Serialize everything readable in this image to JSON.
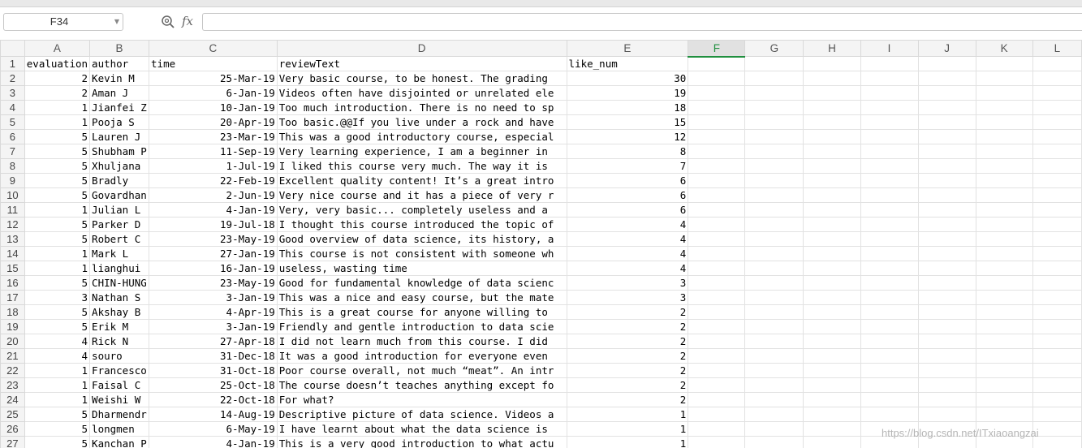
{
  "formula_bar": {
    "name_box": "F34",
    "formula_value": "",
    "zoom_icon": "zoom-magnifier-icon",
    "fx_label": "fx"
  },
  "columns": [
    "A",
    "B",
    "C",
    "D",
    "E",
    "F",
    "G",
    "H",
    "I",
    "J",
    "K",
    "L"
  ],
  "active_column": "F",
  "headers": {
    "row_number": "1",
    "evaluation": "evaluation",
    "author": "author",
    "time": "time",
    "reviewText": "reviewText",
    "like_num": "like_num"
  },
  "rows": [
    {
      "n": "2",
      "evaluation": "2",
      "author": "Kevin M",
      "time": "25-Mar-19",
      "reviewText": "Very basic course, to be honest. The grading",
      "like_num": "30"
    },
    {
      "n": "3",
      "evaluation": "2",
      "author": "Aman J",
      "time": "6-Jan-19",
      "reviewText": "Videos often have disjointed or unrelated ele",
      "like_num": "19"
    },
    {
      "n": "4",
      "evaluation": "1",
      "author": "Jianfei Z",
      "time": "10-Jan-19",
      "reviewText": "Too much introduction. There is no need to sp",
      "like_num": "18"
    },
    {
      "n": "5",
      "evaluation": "1",
      "author": "Pooja S",
      "time": "20-Apr-19",
      "reviewText": "Too basic.@@If you live under a rock and have",
      "like_num": "15"
    },
    {
      "n": "6",
      "evaluation": "5",
      "author": "Lauren J",
      "time": "23-Mar-19",
      "reviewText": "This was a good introductory course, especial",
      "like_num": "12"
    },
    {
      "n": "7",
      "evaluation": "5",
      "author": "Shubham P",
      "time": "11-Sep-19",
      "reviewText": "Very learning experience, I am a beginner in",
      "like_num": "8"
    },
    {
      "n": "8",
      "evaluation": "5",
      "author": "Xhuljana",
      "time": "1-Jul-19",
      "reviewText": "I liked this course very much. The way it is",
      "like_num": "7"
    },
    {
      "n": "9",
      "evaluation": "5",
      "author": "Bradly",
      "time": "22-Feb-19",
      "reviewText": "Excellent quality content! It’s a great intro",
      "like_num": "6"
    },
    {
      "n": "10",
      "evaluation": "5",
      "author": "Govardhan",
      "time": "2-Jun-19",
      "reviewText": "Very nice course and it has a piece of very r",
      "like_num": "6"
    },
    {
      "n": "11",
      "evaluation": "1",
      "author": "Julian L",
      "time": "4-Jan-19",
      "reviewText": "Very, very basic... completely useless and a",
      "like_num": "6"
    },
    {
      "n": "12",
      "evaluation": "5",
      "author": "Parker D",
      "time": "19-Jul-18",
      "reviewText": "I thought this course introduced the topic of",
      "like_num": "4"
    },
    {
      "n": "13",
      "evaluation": "5",
      "author": "Robert C",
      "time": "23-May-19",
      "reviewText": "Good overview of data science, its history, a",
      "like_num": "4"
    },
    {
      "n": "14",
      "evaluation": "1",
      "author": "Mark L",
      "time": "27-Jan-19",
      "reviewText": "This course is not consistent with someone wh",
      "like_num": "4"
    },
    {
      "n": "15",
      "evaluation": "1",
      "author": "lianghui",
      "time": "16-Jan-19",
      "reviewText": "useless, wasting time",
      "like_num": "4"
    },
    {
      "n": "16",
      "evaluation": "5",
      "author": "CHIN-HUNG",
      "time": "23-May-19",
      "reviewText": "Good for fundamental knowledge of data scienc",
      "like_num": "3"
    },
    {
      "n": "17",
      "evaluation": "3",
      "author": "Nathan S",
      "time": "3-Jan-19",
      "reviewText": "This was a nice and easy course, but the mate",
      "like_num": "3"
    },
    {
      "n": "18",
      "evaluation": "5",
      "author": "Akshay B",
      "time": "4-Apr-19",
      "reviewText": "This is a great course for anyone willing to",
      "like_num": "2"
    },
    {
      "n": "19",
      "evaluation": "5",
      "author": "Erik M",
      "time": "3-Jan-19",
      "reviewText": "Friendly and gentle introduction to data scie",
      "like_num": "2"
    },
    {
      "n": "20",
      "evaluation": "4",
      "author": "Rick N",
      "time": "27-Apr-18",
      "reviewText": "I did not learn much from this course. I did",
      "like_num": "2"
    },
    {
      "n": "21",
      "evaluation": "4",
      "author": "souro",
      "time": "31-Dec-18",
      "reviewText": "It was a good introduction for everyone even",
      "like_num": "2"
    },
    {
      "n": "22",
      "evaluation": "1",
      "author": "Francesco",
      "time": "31-Oct-18",
      "reviewText": "Poor course overall, not much “meat”. An intr",
      "like_num": "2"
    },
    {
      "n": "23",
      "evaluation": "1",
      "author": "Faisal C",
      "time": "25-Oct-18",
      "reviewText": "The course doesn’t teaches anything except fo",
      "like_num": "2"
    },
    {
      "n": "24",
      "evaluation": "1",
      "author": "Weishi W",
      "time": "22-Oct-18",
      "reviewText": "For what?",
      "like_num": "2"
    },
    {
      "n": "25",
      "evaluation": "5",
      "author": "Dharmendr",
      "time": "14-Aug-19",
      "reviewText": "Descriptive picture of data science. Videos a",
      "like_num": "1"
    },
    {
      "n": "26",
      "evaluation": "5",
      "author": "longmen",
      "time": "6-May-19",
      "reviewText": "I have learnt about what the data science is",
      "like_num": "1"
    },
    {
      "n": "27",
      "evaluation": "5",
      "author": "Kanchan P",
      "time": "4-Jan-19",
      "reviewText": "This is a very good introduction to what actu",
      "like_num": "1"
    }
  ],
  "watermark": "https://blog.csdn.net/ITxiaoangzai",
  "colors": {
    "active_column": "#1f8f3e",
    "header_bg": "#f4f4f4",
    "grid_line": "#e2e2e2"
  }
}
